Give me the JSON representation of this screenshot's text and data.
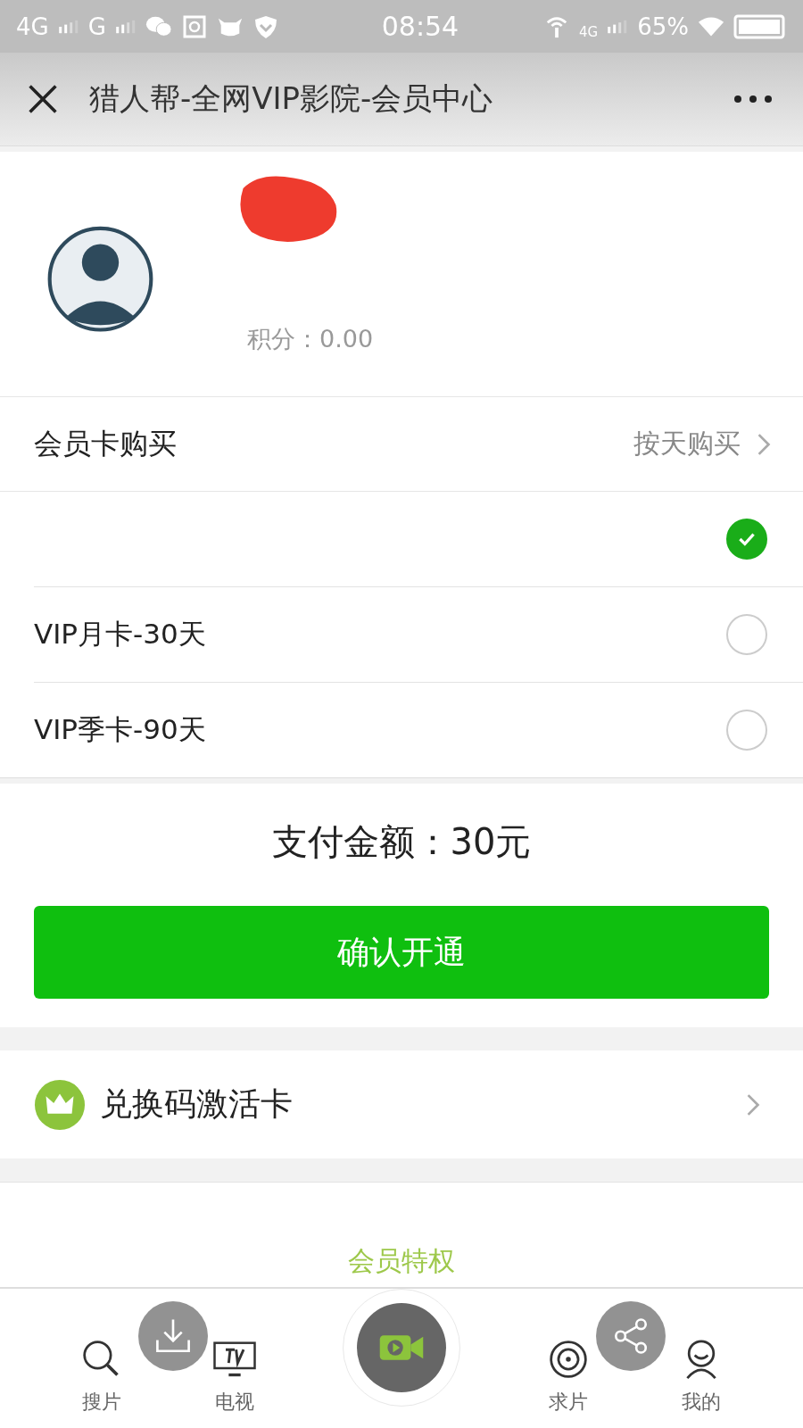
{
  "status_bar": {
    "network_1": "4G",
    "network_2": "G",
    "time": "08:54",
    "network_3": "4G",
    "battery": "65%"
  },
  "header": {
    "title": "猎人帮-全网VIP影院-会员中心"
  },
  "profile": {
    "points": "积分：0.00"
  },
  "membership": {
    "title": "会员卡购买",
    "link": "按天购买",
    "options": [
      {
        "selected": true
      },
      {
        "label": "VIP月卡-30天",
        "selected": false
      },
      {
        "label": "VIP季卡-90天",
        "selected": false
      }
    ]
  },
  "payment": {
    "amount": "支付金额：30元",
    "confirm_button": "确认开通"
  },
  "redeem": {
    "label": "兑换码激活卡"
  },
  "privileges": {
    "title": "会员特权"
  },
  "tab_bar": {
    "tabs": [
      {
        "label": "搜片",
        "kind": "search"
      },
      {
        "label": "电视",
        "kind": "tv"
      },
      {
        "kind": "camera"
      },
      {
        "label": "求片",
        "kind": "target"
      },
      {
        "label": "我的",
        "kind": "person"
      }
    ]
  }
}
